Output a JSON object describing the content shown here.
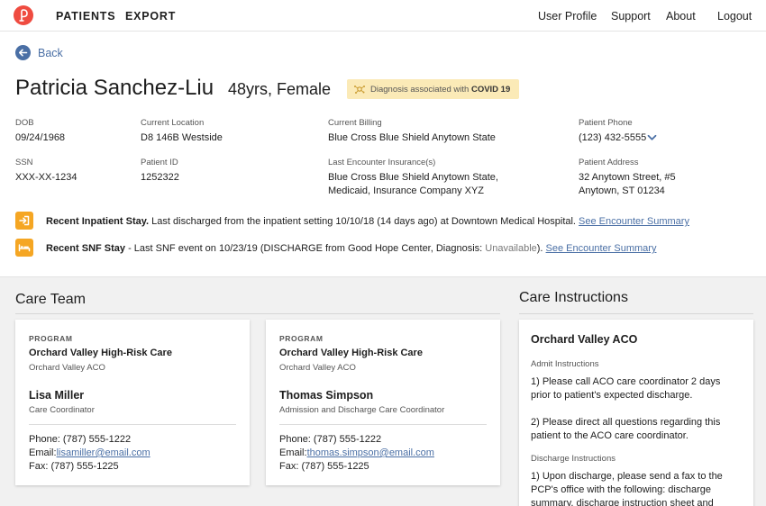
{
  "nav": {
    "brand": "logo",
    "left": [
      "PATIENTS",
      "EXPORT"
    ],
    "right": [
      "User Profile",
      "Support",
      "About",
      "Logout"
    ]
  },
  "back": {
    "label": "Back",
    "icon": "arrow-left-icon"
  },
  "patient": {
    "name": "Patricia Sanchez-Liu",
    "age_gender": "48yrs, Female",
    "diagnosis_badge": {
      "text": "Diagnosis associated with ",
      "bold": "COVID 19",
      "icon": "virus-icon"
    }
  },
  "info": {
    "dob_label": "DOB",
    "dob": "09/24/1968",
    "location_label": "Current Location",
    "location": "D8 146B Westside",
    "billing_label": "Current Billing",
    "billing": "Blue Cross Blue Shield Anytown State",
    "phone_label": "Patient Phone",
    "phone": "(123) 432-5555",
    "ssn_label": "SSN",
    "ssn": "XXX-XX-1234",
    "pid_label": "Patient ID",
    "pid": "1252322",
    "insurance_label": "Last Encounter Insurance(s)",
    "insurance_line1": "Blue Cross Blue Shield Anytown State,",
    "insurance_line2": "Medicaid, Insurance Company XYZ",
    "address_label": "Patient Address",
    "address_line1": "32 Anytown Street, #5",
    "address_line2": "Anytown, ST 01234"
  },
  "encounters": {
    "inpatient": {
      "title": "Recent Inpatient Stay.",
      "text": " Last discharged from the inpatient setting 10/10/18 (14 days ago) at Downtown Medical Hospital. ",
      "link": "See Encounter Summary",
      "icon": "enter-icon"
    },
    "snf": {
      "title": "Recent SNF Stay",
      "text": " - Last SNF event on 10/23/19 (DISCHARGE from Good Hope Center, Diagnosis: ",
      "muted": "Unavailable",
      "text_after": "). ",
      "link": "See Encounter Summary",
      "icon": "bed-icon"
    }
  },
  "care_team": {
    "title": "Care Team",
    "members": [
      {
        "program_label": "PROGRAM",
        "program": "Orchard Valley High-Risk Care",
        "org": "Orchard Valley ACO",
        "name": "Lisa Miller",
        "role": "Care Coordinator",
        "phone": "Phone: (787) 555-1222",
        "email_label": "Email:",
        "email": "lisamiller@email.com",
        "fax": "Fax: (787) 555-1225"
      },
      {
        "program_label": "PROGRAM",
        "program": "Orchard Valley High-Risk Care",
        "org": "Orchard Valley ACO",
        "name": "Thomas Simpson",
        "role": "Admission and Discharge Care Coordinator",
        "phone": "Phone: (787) 555-1222",
        "email_label": "Email:",
        "email": "thomas.simpson@email.com",
        "fax": "Fax: (787) 555-1225"
      }
    ]
  },
  "care_instructions": {
    "title": "Care Instructions",
    "org": "Orchard Valley ACO",
    "admit_label": "Admit Instructions",
    "admit_1_l1": "1) Please call ACO care coordinator 2 days",
    "admit_1_l2": "prior to patient's expected discharge.",
    "admit_2_l1": "2) Please direct all questions regarding this",
    "admit_2_l2": "patient to the ACO care coordinator.",
    "discharge_label": "Discharge Instructions",
    "discharge_1_l1": "1) Upon discharge, please send a fax to the",
    "discharge_1_l2": "PCP's office with the following: discharge",
    "discharge_1_l3": "summary, discharge instruction sheet and"
  },
  "colors": {
    "accent": "#4a6fa5",
    "brand": "#ef4b40",
    "warning": "#f5a623",
    "badge": "#fbeab7"
  }
}
